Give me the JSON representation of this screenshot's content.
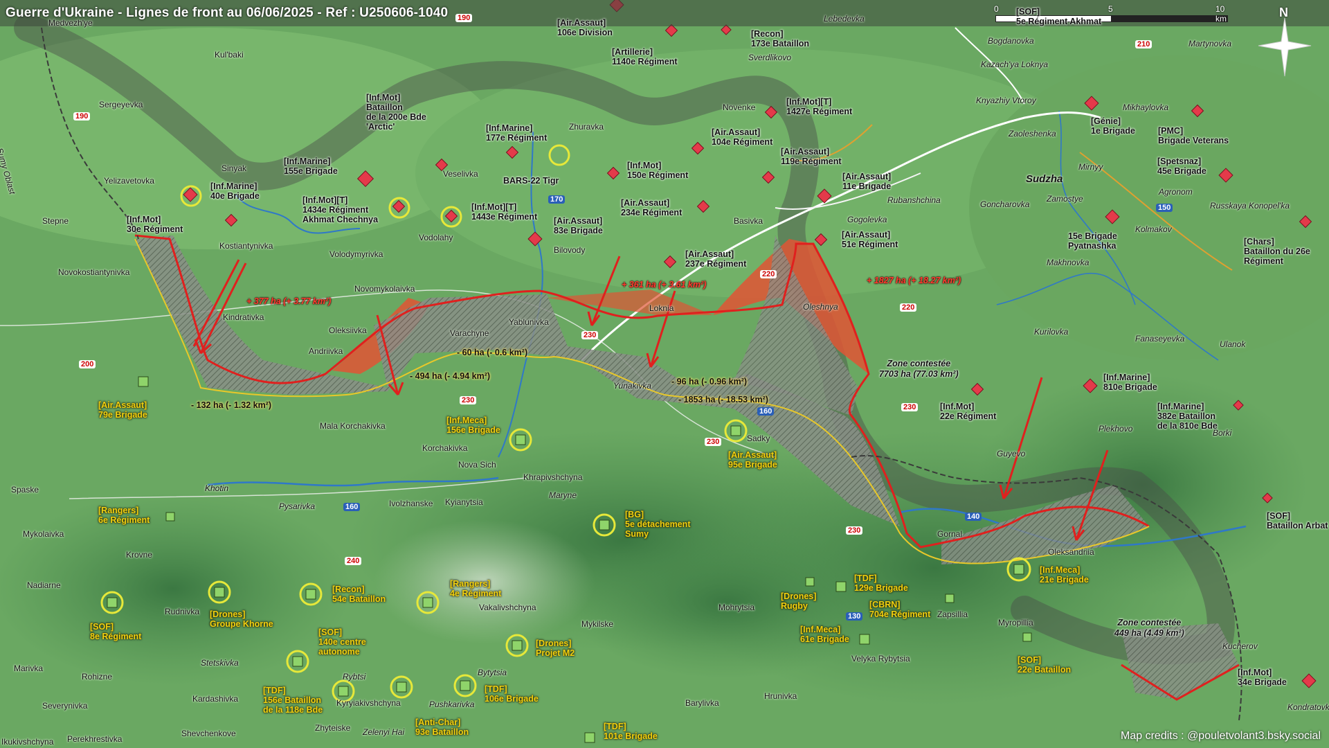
{
  "title": "Guerre d'Ukraine - Lignes de front au 06/06/2025 - Ref : U250606-1040",
  "credits": "Map credits : @pouletvolant3.bsky.social",
  "scale": {
    "ticks": [
      "0",
      "5",
      "10 km"
    ]
  },
  "compass": "N",
  "colors": {
    "terrain_low": "#7cba6c",
    "terrain_high": "#3f7d45",
    "russian_gain": "#e05535",
    "frontline": "#e0201e",
    "contested": "#7a7a7a",
    "border": "#333333",
    "ua_marker": "#d8e03a",
    "ru_marker": "#e43a4a"
  },
  "russian_units": [
    {
      "label": "[Air.Assaut]\n106e Division"
    },
    {
      "label": "[Recon]\n173e Bataillon"
    },
    {
      "label": "[Artillerie]\n1140e Régiment"
    },
    {
      "label": "[Inf.Mot][T]\n1427e Régiment"
    },
    {
      "label": "[Air.Assaut]\n104e Régiment"
    },
    {
      "label": "[Air.Assaut]\n119e Régiment"
    },
    {
      "label": "[Air.Assaut]\n11e Brigade"
    },
    {
      "label": "[Air.Assaut]\n51e Régiment"
    },
    {
      "label": "[Inf.Mot]\nBataillon\nde la 200e Bde\n'Arctic'"
    },
    {
      "label": "[Inf.Marine]\n177e Régiment"
    },
    {
      "label": "[Inf.Mot]\n150e Régiment"
    },
    {
      "label": "BARS-22 Tigr"
    },
    {
      "label": "[Inf.Marine]\n155e Brigade"
    },
    {
      "label": "[Inf.Marine]\n40e Brigade"
    },
    {
      "label": "[Inf.Mot][T]\n1434e Régiment\nAkhmat Chechnya"
    },
    {
      "label": "[Inf.Mot][T]\n1443e Régiment"
    },
    {
      "label": "[Air.Assaut]\n83e Brigade"
    },
    {
      "label": "[Air.Assaut]\n234e Régiment"
    },
    {
      "label": "[Air.Assaut]\n237e Régiment"
    },
    {
      "label": "[Inf.Mot]\n30e Régiment"
    },
    {
      "label": "[Génie]\n1e Brigade"
    },
    {
      "label": "[PMC]\nBrigade Veterans"
    },
    {
      "label": "[Spetsnaz]\n45e Brigade"
    },
    {
      "label": "15e Brigade\nPyatnashka"
    },
    {
      "label": "[Chars]\nBataillon du 26e\nRégiment"
    },
    {
      "label": "[Inf.Marine]\n810e Brigade"
    },
    {
      "label": "[Inf.Mot]\n22e Régiment"
    },
    {
      "label": "[Inf.Marine]\n382e Bataillon\nde la 810e Bde"
    },
    {
      "label": "[SOF]\nBataillon Arbat"
    },
    {
      "label": "[Inf.Mot]\n34e Brigade"
    },
    {
      "label": "[SOF]\n5e Régiment Akhmat"
    }
  ],
  "ukrainian_units": [
    {
      "label": "[Air.Assaut]\n79e Brigade"
    },
    {
      "label": "[Inf.Meca]\n156e Brigade"
    },
    {
      "label": "[Air.Assaut]\n95e Brigade"
    },
    {
      "label": "[Rangers]\n6e Régiment"
    },
    {
      "label": "[BG]\n5e détachement\nSumy"
    },
    {
      "label": "[SOF]\n8e Régiment"
    },
    {
      "label": "[Drones]\nGroupe Khorne"
    },
    {
      "label": "[Recon]\n54e Bataillon"
    },
    {
      "label": "[Rangers]\n4e Régiment"
    },
    {
      "label": "[SOF]\n140e centre\nautonome"
    },
    {
      "label": "[Drones]\nProjet M2"
    },
    {
      "label": "[TDF]\n156e Bataillon\nde la 118e Bde"
    },
    {
      "label": "[TDF]\n106e Brigade"
    },
    {
      "label": "[Anti-Char]\n93e Bataillon"
    },
    {
      "label": "[TDF]\n101e Brigade"
    },
    {
      "label": "[Drones]\nRugby"
    },
    {
      "label": "[TDF]\n129e Brigade"
    },
    {
      "label": "[CBRN]\n704e Régiment"
    },
    {
      "label": "[Inf.Meca]\n61e Brigade"
    },
    {
      "label": "[Inf.Meca]\n21e Brigade"
    },
    {
      "label": "[SOF]\n22e Bataillon"
    }
  ],
  "areas": {
    "gain_377": "+ 377 ha (+ 3.77 km²)",
    "gain_361": "+ 361 ha (+ 3.61 km²)",
    "gain_1827": "+ 1827 ha (+ 18.27 km²)",
    "loss_60": "- 60 ha (- 0.6 km²)",
    "loss_494": "- 494 ha (- 4.94 km²)",
    "loss_132": "- 132 ha (- 1.32 km²)",
    "loss_96": "- 96 ha (- 0.96 km²)",
    "loss_1853": "- 1853 ha (- 18.53 km²)",
    "zone_1": "Zone contestée\n7703 ha (77.03 km²)",
    "zone_2": "Zone contestée\n449 ha (4.49 km²)"
  },
  "places": [
    {
      "name": "Medvezh'ye"
    },
    {
      "name": "Kul'baki"
    },
    {
      "name": "Sergeyevka"
    },
    {
      "name": "Sinyak"
    },
    {
      "name": "Yelizavetovka"
    },
    {
      "name": "Stepne"
    },
    {
      "name": "Kostiantynivka"
    },
    {
      "name": "Novokostiantynivka"
    },
    {
      "name": "Volodymyrivka"
    },
    {
      "name": "Vodolahy"
    },
    {
      "name": "Veselivka"
    },
    {
      "name": "Zhuravka"
    },
    {
      "name": "Bilovody"
    },
    {
      "name": "Novomykolaivka"
    },
    {
      "name": "Kindrativka"
    },
    {
      "name": "Oleksiivka"
    },
    {
      "name": "Andriivka"
    },
    {
      "name": "Varachyne"
    },
    {
      "name": "Yablunivka"
    },
    {
      "name": "Loknia"
    },
    {
      "name": "Yunakivka"
    },
    {
      "name": "Basivka"
    },
    {
      "name": "Novenke"
    },
    {
      "name": "Sverdlikovo"
    },
    {
      "name": "Lebedevka"
    },
    {
      "name": "Bogdanovka"
    },
    {
      "name": "Kazach'ya Loknya"
    },
    {
      "name": "Knyazhiy Vtoroy"
    },
    {
      "name": "Zaoleshenka"
    },
    {
      "name": "Sudzha"
    },
    {
      "name": "Goncharovka"
    },
    {
      "name": "Zamostye"
    },
    {
      "name": "Rubanshchina"
    },
    {
      "name": "Gogolevka"
    },
    {
      "name": "Oleshnya"
    },
    {
      "name": "Mirnyy"
    },
    {
      "name": "Mikhaylovka"
    },
    {
      "name": "Martynovka"
    },
    {
      "name": "Agronom"
    },
    {
      "name": "Russkaya Konopel'ka"
    },
    {
      "name": "Kolmakov"
    },
    {
      "name": "Makhnovka"
    },
    {
      "name": "Kurilovka"
    },
    {
      "name": "Fanaseyevka"
    },
    {
      "name": "Ulanok"
    },
    {
      "name": "Plekhovo"
    },
    {
      "name": "Borki"
    },
    {
      "name": "Guyevo"
    },
    {
      "name": "Gornal"
    },
    {
      "name": "Oleksandriia"
    },
    {
      "name": "Sadky"
    },
    {
      "name": "Mala Korchakivka"
    },
    {
      "name": "Korchakivka"
    },
    {
      "name": "Nova Sich"
    },
    {
      "name": "Khrapivshchyna"
    },
    {
      "name": "Maryne"
    },
    {
      "name": "Kyianytsia"
    },
    {
      "name": "Ivolzhanske"
    },
    {
      "name": "Pysarivka"
    },
    {
      "name": "Khotin"
    },
    {
      "name": "Spaske"
    },
    {
      "name": "Mykolaivka"
    },
    {
      "name": "Krovne"
    },
    {
      "name": "Nadiarne"
    },
    {
      "name": "Rudnivka"
    },
    {
      "name": "Vakalivshchyna"
    },
    {
      "name": "Mykilske"
    },
    {
      "name": "Mohrytsia"
    },
    {
      "name": "Zapsillia"
    },
    {
      "name": "Myropillia"
    },
    {
      "name": "Velyka Rybytsia"
    },
    {
      "name": "Stetskivka"
    },
    {
      "name": "Marivka"
    },
    {
      "name": "Rohizne"
    },
    {
      "name": "Severynivka"
    },
    {
      "name": "Kardashivka"
    },
    {
      "name": "Rybtsi"
    },
    {
      "name": "Kyryiakivshchyna"
    },
    {
      "name": "Pushkarivka"
    },
    {
      "name": "Bytytsia"
    },
    {
      "name": "Barylivka"
    },
    {
      "name": "Hrunivka"
    },
    {
      "name": "Zhyteiske"
    },
    {
      "name": "Zelenyi Hai"
    },
    {
      "name": "Shevchenkove"
    },
    {
      "name": "Perekhrestivka"
    },
    {
      "name": "Kucherov"
    },
    {
      "name": "Kondratovka"
    },
    {
      "name": "Sumy Oblast"
    },
    {
      "name": "Ikukivshchyna"
    }
  ],
  "roads": [
    {
      "num": "190"
    },
    {
      "num": "190"
    },
    {
      "num": "170"
    },
    {
      "num": "220"
    },
    {
      "num": "220"
    },
    {
      "num": "210"
    },
    {
      "num": "150"
    },
    {
      "num": "200"
    },
    {
      "num": "230"
    },
    {
      "num": "230"
    },
    {
      "num": "230"
    },
    {
      "num": "230"
    },
    {
      "num": "230"
    },
    {
      "num": "160"
    },
    {
      "num": "160"
    },
    {
      "num": "240"
    },
    {
      "num": "130"
    },
    {
      "num": "140"
    }
  ]
}
